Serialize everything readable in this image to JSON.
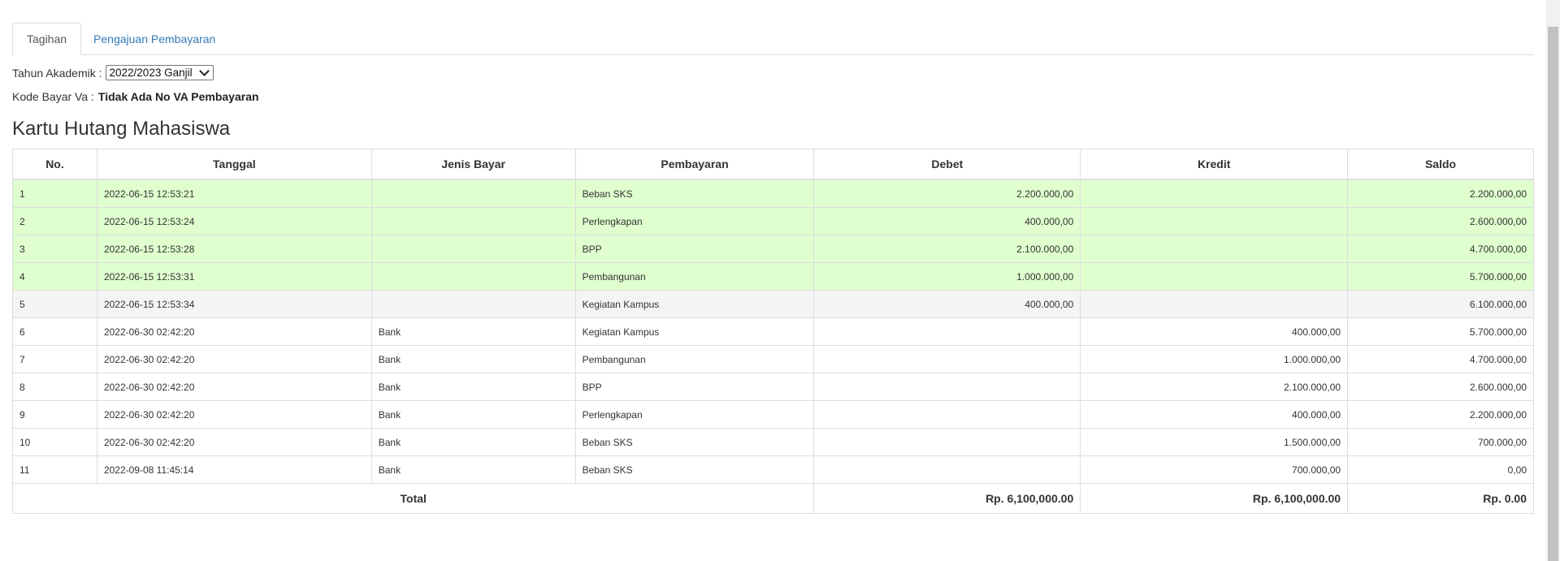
{
  "tabs": [
    {
      "label": "Tagihan",
      "active": true
    },
    {
      "label": "Pengajuan Pembayaran",
      "active": false
    }
  ],
  "filter": {
    "academic_year_label": "Tahun Akademik :",
    "academic_year_value": "2022/2023 Ganjil",
    "kode_bayar_label": "Kode Bayar Va :",
    "kode_bayar_value": "Tidak Ada No VA Pembayaran"
  },
  "section_title": "Kartu Hutang Mahasiswa",
  "table": {
    "headers": [
      "No.",
      "Tanggal",
      "Jenis Bayar",
      "Pembayaran",
      "Debet",
      "Kredit",
      "Saldo"
    ],
    "rows": [
      {
        "no": "1",
        "tanggal": "2022-06-15 12:53:21",
        "jenis": "",
        "pembayaran": "Beban SKS",
        "debet": "2.200.000,00",
        "kredit": "",
        "saldo": "2.200.000,00",
        "status": "paid"
      },
      {
        "no": "2",
        "tanggal": "2022-06-15 12:53:24",
        "jenis": "",
        "pembayaran": "Perlengkapan",
        "debet": "400.000,00",
        "kredit": "",
        "saldo": "2.600.000,00",
        "status": "paid"
      },
      {
        "no": "3",
        "tanggal": "2022-06-15 12:53:28",
        "jenis": "",
        "pembayaran": "BPP",
        "debet": "2.100.000,00",
        "kredit": "",
        "saldo": "4.700.000,00",
        "status": "paid"
      },
      {
        "no": "4",
        "tanggal": "2022-06-15 12:53:31",
        "jenis": "",
        "pembayaran": "Pembangunan",
        "debet": "1.000.000,00",
        "kredit": "",
        "saldo": "5.700.000,00",
        "status": "paid"
      },
      {
        "no": "5",
        "tanggal": "2022-06-15 12:53:34",
        "jenis": "",
        "pembayaran": "Kegiatan Kampus",
        "debet": "400.000,00",
        "kredit": "",
        "saldo": "6.100.000,00",
        "status": "gray"
      },
      {
        "no": "6",
        "tanggal": "2022-06-30 02:42:20",
        "jenis": "Bank",
        "pembayaran": "Kegiatan Kampus",
        "debet": "",
        "kredit": "400.000,00",
        "saldo": "5.700.000,00",
        "status": "plain"
      },
      {
        "no": "7",
        "tanggal": "2022-06-30 02:42:20",
        "jenis": "Bank",
        "pembayaran": "Pembangunan",
        "debet": "",
        "kredit": "1.000.000,00",
        "saldo": "4.700.000,00",
        "status": "plain"
      },
      {
        "no": "8",
        "tanggal": "2022-06-30 02:42:20",
        "jenis": "Bank",
        "pembayaran": "BPP",
        "debet": "",
        "kredit": "2.100.000,00",
        "saldo": "2.600.000,00",
        "status": "plain"
      },
      {
        "no": "9",
        "tanggal": "2022-06-30 02:42:20",
        "jenis": "Bank",
        "pembayaran": "Perlengkapan",
        "debet": "",
        "kredit": "400.000,00",
        "saldo": "2.200.000,00",
        "status": "plain"
      },
      {
        "no": "10",
        "tanggal": "2022-06-30 02:42:20",
        "jenis": "Bank",
        "pembayaran": "Beban SKS",
        "debet": "",
        "kredit": "1.500.000,00",
        "saldo": "700.000,00",
        "status": "plain"
      },
      {
        "no": "11",
        "tanggal": "2022-09-08 11:45:14",
        "jenis": "Bank",
        "pembayaran": "Beban SKS",
        "debet": "",
        "kredit": "700.000,00",
        "saldo": "0,00",
        "status": "plain"
      }
    ],
    "total": {
      "label": "Total",
      "debet": "Rp. 6,100,000.00",
      "kredit": "Rp. 6,100,000.00",
      "saldo": "Rp. 0.00"
    }
  },
  "colors": {
    "paid_row": "#dfffcf",
    "gray_row": "#f4f4f4",
    "link": "#337ab7",
    "border": "#dddddd"
  }
}
